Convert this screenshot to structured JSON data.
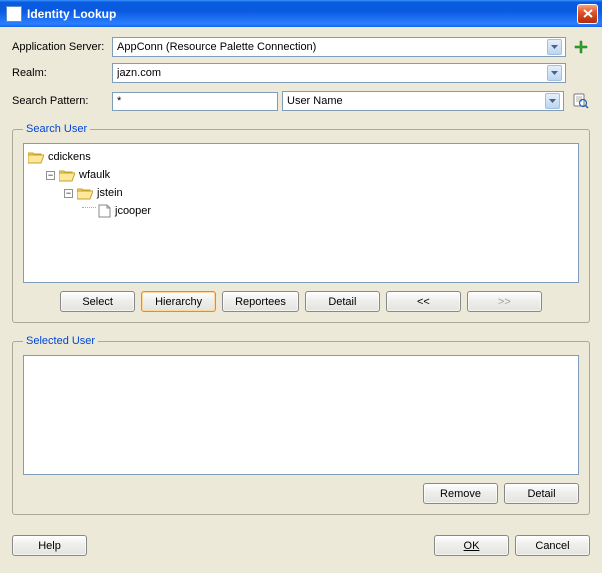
{
  "window": {
    "title": "Identity Lookup"
  },
  "form": {
    "app_server_label": "Application Server:",
    "app_server_value": "AppConn (Resource Palette Connection)",
    "realm_label": "Realm:",
    "realm_value": "jazn.com",
    "search_pattern_label": "Search Pattern:",
    "search_pattern_value": "*",
    "search_type_value": "User Name"
  },
  "search_user": {
    "legend": "Search User",
    "tree": {
      "n0": "cdickens",
      "n1": "wfaulk",
      "n2": "jstein",
      "n3": "jcooper"
    },
    "buttons": {
      "select": "Select",
      "hierarchy": "Hierarchy",
      "reportees": "Reportees",
      "detail": "Detail",
      "prev": "<<",
      "next": ">>"
    }
  },
  "selected_user": {
    "legend": "Selected User",
    "buttons": {
      "remove": "Remove",
      "detail": "Detail"
    }
  },
  "footer": {
    "help": "Help",
    "ok": "OK",
    "cancel": "Cancel"
  }
}
